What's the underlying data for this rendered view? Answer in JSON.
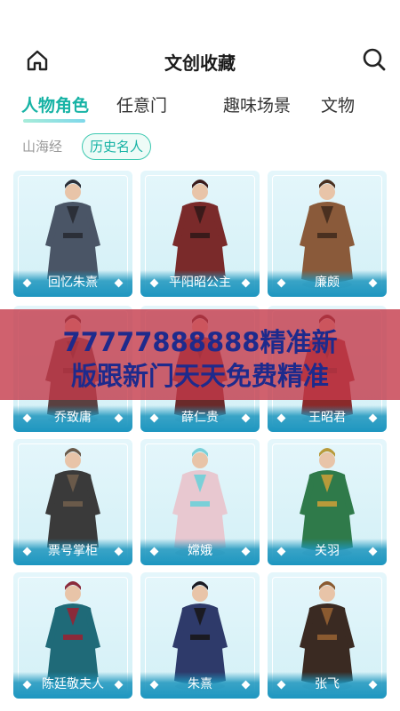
{
  "header": {
    "title": "文创收藏",
    "home_icon": "home-icon",
    "search_icon": "search-icon"
  },
  "tabs": [
    {
      "label": "人物角色",
      "active": true
    },
    {
      "label": "任意门",
      "active": false
    },
    {
      "label": "趣味场景",
      "active": false
    },
    {
      "label": "文物",
      "active": false
    }
  ],
  "subtabs": [
    {
      "label": "山海经",
      "active": false
    },
    {
      "label": "历史名人",
      "active": true
    }
  ],
  "cards": [
    {
      "name": "回忆朱熹",
      "robe": "#4a5566",
      "accent": "#2b2f38"
    },
    {
      "name": "平阳昭公主",
      "robe": "#7a2a2a",
      "accent": "#3a1a1a"
    },
    {
      "name": "廉颇",
      "robe": "#8a5a3a",
      "accent": "#4a3020"
    },
    {
      "name": "乔致庸",
      "robe": "#5a4040",
      "accent": "#2e2020"
    },
    {
      "name": "薛仁贵",
      "robe": "#6a2a2a",
      "accent": "#331818"
    },
    {
      "name": "王昭君",
      "robe": "#8a2a2a",
      "accent": "#4a1515"
    },
    {
      "name": "票号掌柜",
      "robe": "#3a3a3a",
      "accent": "#6a5a4a"
    },
    {
      "name": "嫦娥",
      "robe": "#e8c8d0",
      "accent": "#7ad0d8"
    },
    {
      "name": "关羽",
      "robe": "#2f7a4a",
      "accent": "#b89a3a"
    },
    {
      "name": "陈廷敬夫人",
      "robe": "#1f6a78",
      "accent": "#8a2a3a"
    },
    {
      "name": "朱熹",
      "robe": "#2e3a6a",
      "accent": "#1a1a22"
    },
    {
      "name": "张飞",
      "robe": "#3a2a22",
      "accent": "#8a5a30"
    }
  ],
  "overlay_banner": {
    "line1": "77777888888精准新",
    "line2": "版跟新门天天免费精准"
  },
  "colors": {
    "accent": "#17b3a5",
    "banner": "#c43a4a",
    "banner_text": "#1e2a8c"
  }
}
